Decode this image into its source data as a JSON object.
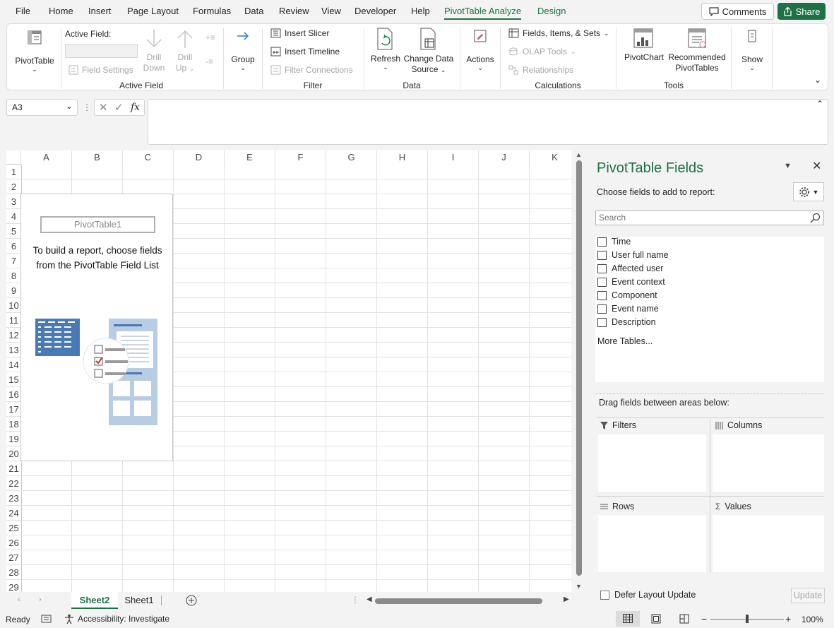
{
  "menu": {
    "tabs": [
      "File",
      "Home",
      "Insert",
      "Page Layout",
      "Formulas",
      "Data",
      "Review",
      "View",
      "Developer",
      "Help",
      "PivotTable Analyze",
      "Design"
    ],
    "comments_label": "Comments",
    "share_label": "Share"
  },
  "ribbon": {
    "pivottable_label": "PivotTable",
    "active_field_title": "Active Field:",
    "field_settings": "Field Settings",
    "drill_down": [
      "Drill",
      "Down"
    ],
    "drill_up": [
      "Drill",
      "Up"
    ],
    "group_label": "Group",
    "insert_slicer": "Insert Slicer",
    "insert_timeline": "Insert Timeline",
    "filter_connections": "Filter Connections",
    "refresh": "Refresh",
    "change_data_source": [
      "Change Data",
      "Source"
    ],
    "actions": "Actions",
    "fields_items_sets": "Fields, Items, & Sets",
    "olap_tools": "OLAP Tools",
    "relationships": "Relationships",
    "pivotchart": "PivotChart",
    "recommended": [
      "Recommended",
      "PivotTables"
    ],
    "show": "Show",
    "groups": {
      "active_field": "Active Field",
      "filter": "Filter",
      "data": "Data",
      "calculations": "Calculations",
      "tools": "Tools"
    }
  },
  "formula_bar": {
    "name_box": "A3",
    "fx": "fx",
    "formula": ""
  },
  "grid": {
    "columns": [
      "A",
      "B",
      "C",
      "D",
      "E",
      "F",
      "G",
      "H",
      "I",
      "J",
      "K"
    ],
    "rows": [
      "1",
      "2",
      "3",
      "4",
      "5",
      "6",
      "7",
      "8",
      "9",
      "10",
      "11",
      "12",
      "13",
      "14",
      "15",
      "16",
      "17",
      "18",
      "19",
      "20",
      "21",
      "22",
      "23",
      "24",
      "25",
      "26",
      "27",
      "28",
      "29"
    ]
  },
  "pivot_placeholder": {
    "name": "PivotTable1",
    "help_line1": "To build a report, choose fields",
    "help_line2": "from the PivotTable Field List"
  },
  "sheets": {
    "tabs": [
      "Sheet2",
      "Sheet1"
    ],
    "active": "Sheet2"
  },
  "pane": {
    "title": "PivotTable Fields",
    "subtitle": "Choose fields to add to report:",
    "search_placeholder": "Search",
    "fields": [
      "Time",
      "User full name",
      "Affected user",
      "Event context",
      "Component",
      "Event name",
      "Description"
    ],
    "more_tables": "More Tables...",
    "drag_hint": "Drag fields between areas below:",
    "areas": {
      "filters": "Filters",
      "columns": "Columns",
      "rows": "Rows",
      "values": "Values"
    },
    "defer_label": "Defer Layout Update",
    "update_label": "Update"
  },
  "status": {
    "ready": "Ready",
    "accessibility": "Accessibility: Investigate",
    "zoom": "100%"
  },
  "colors": {
    "accent": "#1e7145"
  }
}
